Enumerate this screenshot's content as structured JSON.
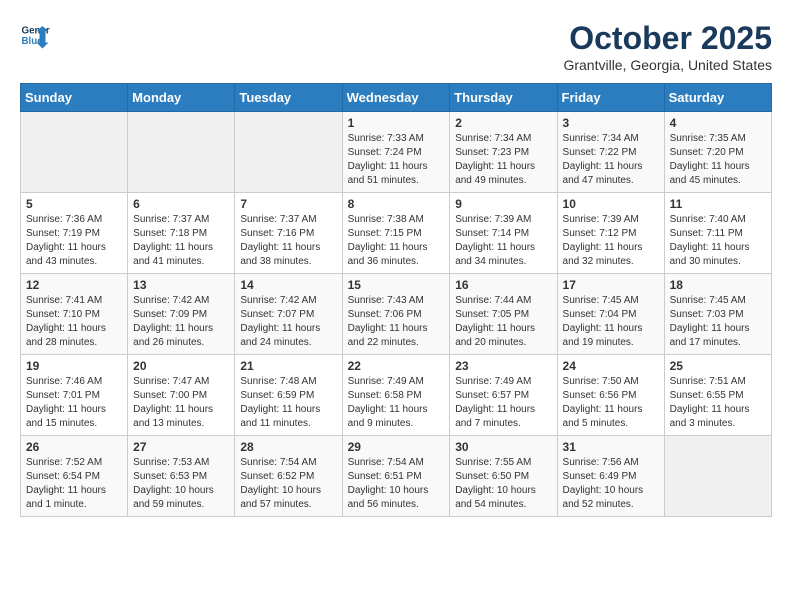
{
  "header": {
    "logo_line1": "General",
    "logo_line2": "Blue",
    "month": "October 2025",
    "location": "Grantville, Georgia, United States"
  },
  "days_of_week": [
    "Sunday",
    "Monday",
    "Tuesday",
    "Wednesday",
    "Thursday",
    "Friday",
    "Saturday"
  ],
  "weeks": [
    [
      {
        "num": "",
        "info": ""
      },
      {
        "num": "",
        "info": ""
      },
      {
        "num": "",
        "info": ""
      },
      {
        "num": "1",
        "info": "Sunrise: 7:33 AM\nSunset: 7:24 PM\nDaylight: 11 hours and 51 minutes."
      },
      {
        "num": "2",
        "info": "Sunrise: 7:34 AM\nSunset: 7:23 PM\nDaylight: 11 hours and 49 minutes."
      },
      {
        "num": "3",
        "info": "Sunrise: 7:34 AM\nSunset: 7:22 PM\nDaylight: 11 hours and 47 minutes."
      },
      {
        "num": "4",
        "info": "Sunrise: 7:35 AM\nSunset: 7:20 PM\nDaylight: 11 hours and 45 minutes."
      }
    ],
    [
      {
        "num": "5",
        "info": "Sunrise: 7:36 AM\nSunset: 7:19 PM\nDaylight: 11 hours and 43 minutes."
      },
      {
        "num": "6",
        "info": "Sunrise: 7:37 AM\nSunset: 7:18 PM\nDaylight: 11 hours and 41 minutes."
      },
      {
        "num": "7",
        "info": "Sunrise: 7:37 AM\nSunset: 7:16 PM\nDaylight: 11 hours and 38 minutes."
      },
      {
        "num": "8",
        "info": "Sunrise: 7:38 AM\nSunset: 7:15 PM\nDaylight: 11 hours and 36 minutes."
      },
      {
        "num": "9",
        "info": "Sunrise: 7:39 AM\nSunset: 7:14 PM\nDaylight: 11 hours and 34 minutes."
      },
      {
        "num": "10",
        "info": "Sunrise: 7:39 AM\nSunset: 7:12 PM\nDaylight: 11 hours and 32 minutes."
      },
      {
        "num": "11",
        "info": "Sunrise: 7:40 AM\nSunset: 7:11 PM\nDaylight: 11 hours and 30 minutes."
      }
    ],
    [
      {
        "num": "12",
        "info": "Sunrise: 7:41 AM\nSunset: 7:10 PM\nDaylight: 11 hours and 28 minutes."
      },
      {
        "num": "13",
        "info": "Sunrise: 7:42 AM\nSunset: 7:09 PM\nDaylight: 11 hours and 26 minutes."
      },
      {
        "num": "14",
        "info": "Sunrise: 7:42 AM\nSunset: 7:07 PM\nDaylight: 11 hours and 24 minutes."
      },
      {
        "num": "15",
        "info": "Sunrise: 7:43 AM\nSunset: 7:06 PM\nDaylight: 11 hours and 22 minutes."
      },
      {
        "num": "16",
        "info": "Sunrise: 7:44 AM\nSunset: 7:05 PM\nDaylight: 11 hours and 20 minutes."
      },
      {
        "num": "17",
        "info": "Sunrise: 7:45 AM\nSunset: 7:04 PM\nDaylight: 11 hours and 19 minutes."
      },
      {
        "num": "18",
        "info": "Sunrise: 7:45 AM\nSunset: 7:03 PM\nDaylight: 11 hours and 17 minutes."
      }
    ],
    [
      {
        "num": "19",
        "info": "Sunrise: 7:46 AM\nSunset: 7:01 PM\nDaylight: 11 hours and 15 minutes."
      },
      {
        "num": "20",
        "info": "Sunrise: 7:47 AM\nSunset: 7:00 PM\nDaylight: 11 hours and 13 minutes."
      },
      {
        "num": "21",
        "info": "Sunrise: 7:48 AM\nSunset: 6:59 PM\nDaylight: 11 hours and 11 minutes."
      },
      {
        "num": "22",
        "info": "Sunrise: 7:49 AM\nSunset: 6:58 PM\nDaylight: 11 hours and 9 minutes."
      },
      {
        "num": "23",
        "info": "Sunrise: 7:49 AM\nSunset: 6:57 PM\nDaylight: 11 hours and 7 minutes."
      },
      {
        "num": "24",
        "info": "Sunrise: 7:50 AM\nSunset: 6:56 PM\nDaylight: 11 hours and 5 minutes."
      },
      {
        "num": "25",
        "info": "Sunrise: 7:51 AM\nSunset: 6:55 PM\nDaylight: 11 hours and 3 minutes."
      }
    ],
    [
      {
        "num": "26",
        "info": "Sunrise: 7:52 AM\nSunset: 6:54 PM\nDaylight: 11 hours and 1 minute."
      },
      {
        "num": "27",
        "info": "Sunrise: 7:53 AM\nSunset: 6:53 PM\nDaylight: 10 hours and 59 minutes."
      },
      {
        "num": "28",
        "info": "Sunrise: 7:54 AM\nSunset: 6:52 PM\nDaylight: 10 hours and 57 minutes."
      },
      {
        "num": "29",
        "info": "Sunrise: 7:54 AM\nSunset: 6:51 PM\nDaylight: 10 hours and 56 minutes."
      },
      {
        "num": "30",
        "info": "Sunrise: 7:55 AM\nSunset: 6:50 PM\nDaylight: 10 hours and 54 minutes."
      },
      {
        "num": "31",
        "info": "Sunrise: 7:56 AM\nSunset: 6:49 PM\nDaylight: 10 hours and 52 minutes."
      },
      {
        "num": "",
        "info": ""
      }
    ]
  ]
}
